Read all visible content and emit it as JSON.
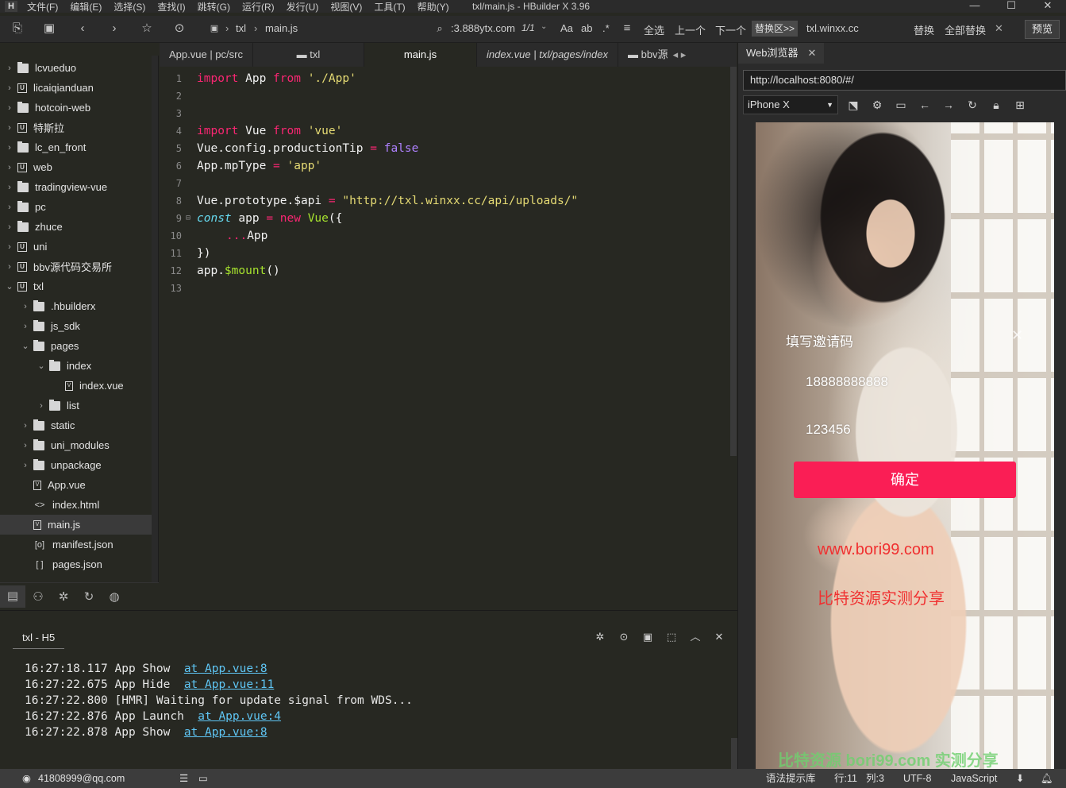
{
  "menubar": {
    "logo": "H",
    "items": [
      "文件(F)",
      "编辑(E)",
      "选择(S)",
      "查找(I)",
      "跳转(G)",
      "运行(R)",
      "发行(U)",
      "视图(V)",
      "工具(T)",
      "帮助(Y)"
    ],
    "title": "txl/main.js - HBuilder X 3.96"
  },
  "toolbar": {
    "breadcrumb_project": "txl",
    "breadcrumb_file": "main.js",
    "search_value": ":3.888ytx.com",
    "match_count": "1/1",
    "case_label": "Aa",
    "word_label": "ab",
    "regex_label": ".*",
    "select_all": "全选",
    "prev": "上一个",
    "next": "下一个",
    "replace_region": "替换区>>",
    "replace_value": "txl.winxx.cc",
    "replace": "替换",
    "replace_all": "全部替换",
    "preview": "预览"
  },
  "sidebar": {
    "items": [
      {
        "label": "lcvueduo",
        "icon": "folder",
        "chev": "›",
        "indent": 0
      },
      {
        "label": "licaiqianduan",
        "icon": "ubox",
        "chev": "›",
        "indent": 0
      },
      {
        "label": "hotcoin-web",
        "icon": "folder",
        "chev": "›",
        "indent": 0
      },
      {
        "label": "特斯拉",
        "icon": "ubox",
        "chev": "›",
        "indent": 0
      },
      {
        "label": "lc_en_front",
        "icon": "folder",
        "chev": "›",
        "indent": 0
      },
      {
        "label": "web",
        "icon": "ubox",
        "chev": "›",
        "indent": 0
      },
      {
        "label": "tradingview-vue",
        "icon": "folder",
        "chev": "›",
        "indent": 0
      },
      {
        "label": "pc",
        "icon": "folder",
        "chev": "›",
        "indent": 0
      },
      {
        "label": "zhuce",
        "icon": "folder",
        "chev": "›",
        "indent": 0
      },
      {
        "label": "uni",
        "icon": "ubox",
        "chev": "›",
        "indent": 0
      },
      {
        "label": "bbv源代码交易所",
        "icon": "ubox",
        "chev": "›",
        "indent": 0
      },
      {
        "label": "txl",
        "icon": "ubox",
        "chev": "⌄",
        "indent": 0
      },
      {
        "label": ".hbuilderx",
        "icon": "folder",
        "chev": "›",
        "indent": 1
      },
      {
        "label": "js_sdk",
        "icon": "folder",
        "chev": "›",
        "indent": 1
      },
      {
        "label": "pages",
        "icon": "folder",
        "chev": "⌄",
        "indent": 1
      },
      {
        "label": "index",
        "icon": "folder",
        "chev": "⌄",
        "indent": 2
      },
      {
        "label": "index.vue",
        "icon": "file",
        "chev": "",
        "indent": 3
      },
      {
        "label": "list",
        "icon": "folder",
        "chev": "›",
        "indent": 2
      },
      {
        "label": "static",
        "icon": "folder",
        "chev": "›",
        "indent": 1
      },
      {
        "label": "uni_modules",
        "icon": "folder",
        "chev": "›",
        "indent": 1
      },
      {
        "label": "unpackage",
        "icon": "folder",
        "chev": "›",
        "indent": 1
      },
      {
        "label": "App.vue",
        "icon": "file",
        "chev": "",
        "indent": 1
      },
      {
        "label": "index.html",
        "icon": "html",
        "chev": "",
        "indent": 1
      },
      {
        "label": "main.js",
        "icon": "file",
        "chev": "",
        "indent": 1,
        "selected": true
      },
      {
        "label": "manifest.json",
        "icon": "json",
        "chev": "",
        "indent": 1
      },
      {
        "label": "pages.json",
        "icon": "brackets",
        "chev": "",
        "indent": 1
      }
    ]
  },
  "tabs": [
    {
      "label": "App.vue | pc/src",
      "active": false,
      "italic": false
    },
    {
      "label": "txl",
      "active": false,
      "italic": false,
      "folder": true
    },
    {
      "label": "main.js",
      "active": true,
      "italic": false
    },
    {
      "label": "index.vue | txl/pages/index",
      "active": false,
      "italic": true
    },
    {
      "label": "bbv源",
      "active": false,
      "italic": false,
      "folder": true
    }
  ],
  "code_lines": [
    {
      "n": "1"
    },
    {
      "n": "2"
    },
    {
      "n": "3"
    },
    {
      "n": "4"
    },
    {
      "n": "5"
    },
    {
      "n": "6"
    },
    {
      "n": "7"
    },
    {
      "n": "8"
    },
    {
      "n": "9"
    },
    {
      "n": "10"
    },
    {
      "n": "11"
    },
    {
      "n": "12"
    },
    {
      "n": "13"
    }
  ],
  "code": {
    "l1": {
      "kw1": "import",
      "id": " App ",
      "kw2": "from",
      "str": " './App'"
    },
    "l4": {
      "kw1": "import",
      "id": " Vue ",
      "kw2": "from",
      "str": " 'vue'"
    },
    "l5": {
      "lhs": "Vue.config.productionTip ",
      "op": "=",
      "val": " false"
    },
    "l6": {
      "lhs": "App.mpType ",
      "op": "=",
      "val": " 'app'"
    },
    "l8": {
      "lhs": "Vue.prototype.$api ",
      "op": "=",
      "val": " \"http://txl.winxx.cc/api/uploads/\""
    },
    "l9": {
      "kw": "const",
      "id": " app ",
      "op": "=",
      "new": " new",
      "fn": " Vue",
      "rest": "({"
    },
    "l10": {
      "spread": "...",
      "id": "App"
    },
    "l11": {
      "text": "})"
    },
    "l12": {
      "id": "app.",
      "fn": "$mount",
      "rest": "()"
    }
  },
  "webpane": {
    "tab_label": "Web浏览器",
    "url": "http://localhost:8080/#/",
    "device": "iPhone X"
  },
  "phone": {
    "invite_label": "填写邀请码",
    "phone_value": "18888888888",
    "password_value": "123456",
    "confirm": "确定",
    "watermark_url": "www.bori99.com",
    "watermark_cn": "比特资源实测分享",
    "watermark_bottom": "比特资源 bori99.com 实测分享"
  },
  "console": {
    "tab_label": "txl - H5",
    "logs": [
      {
        "time": "16:27:18.117",
        "msg": "App Show  ",
        "link": "at App.vue:8"
      },
      {
        "time": "16:27:22.675",
        "msg": "App Hide  ",
        "link": "at App.vue:11"
      },
      {
        "time": "16:27:22.800",
        "msg": "[HMR] Waiting for update signal from WDS...",
        "link": ""
      },
      {
        "time": "16:27:22.876",
        "msg": "App Launch  ",
        "link": "at App.vue:4"
      },
      {
        "time": "16:27:22.878",
        "msg": "App Show  ",
        "link": "at App.vue:8"
      }
    ]
  },
  "statusbar": {
    "user": "41808999@qq.com",
    "syntax": "语法提示库",
    "row": "行:11",
    "col": "列:3",
    "encoding": "UTF-8",
    "language": "JavaScript"
  },
  "colors": {
    "accent_button": "#fa1e55",
    "editor_bg": "#272822",
    "keyword": "#f92672",
    "string": "#e6db74",
    "link": "#5fc6f5"
  }
}
